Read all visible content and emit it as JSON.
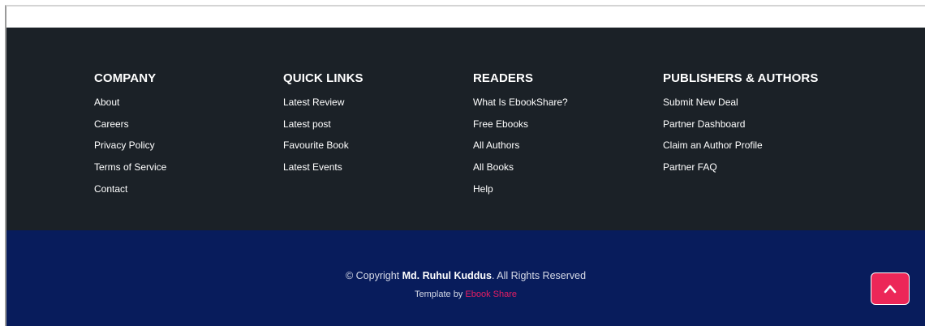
{
  "footer": {
    "columns": [
      {
        "heading": "COMPANY",
        "links": [
          "About",
          "Careers",
          "Privacy Policy",
          "Terms of Service",
          "Contact"
        ]
      },
      {
        "heading": "QUICK LINKS",
        "links": [
          "Latest Review",
          "Latest post",
          "Favourite Book",
          "Latest Events"
        ]
      },
      {
        "heading": "READERS",
        "links": [
          "What Is EbookShare?",
          "Free Ebooks",
          "All Authors",
          "All Books",
          "Help"
        ]
      },
      {
        "heading": "PUBLISHERS & AUTHORS",
        "links": [
          "Submit New Deal",
          "Partner Dashboard",
          "Claim an Author Profile",
          "Partner FAQ"
        ]
      }
    ]
  },
  "copyright": {
    "prefix": "© Copyright ",
    "owner": "Md. Ruhul Kuddus",
    "suffix": ". All Rights Reserved",
    "credit_prefix": "Template by ",
    "credit_link": "Ebook Share"
  },
  "back_to_top": {
    "icon": "chevron-up-icon"
  },
  "colors": {
    "footer_top_bg": "#1b2127",
    "footer_bottom_bg": "#081c5c",
    "accent": "#ec2758",
    "link_accent": "#e91e63"
  }
}
